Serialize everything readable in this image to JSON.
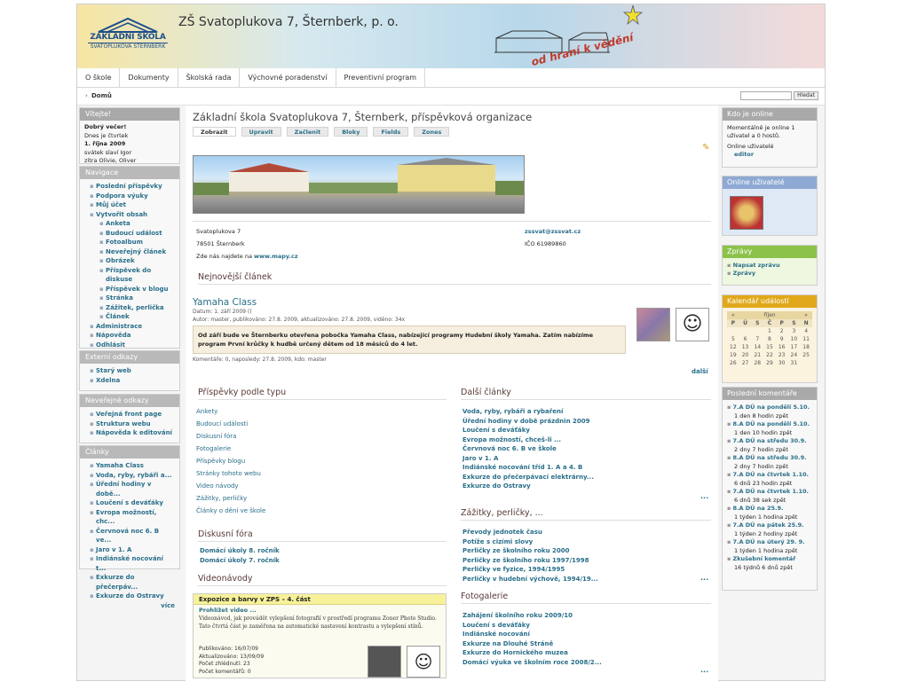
{
  "header": {
    "logo_line1": "ZÁKLADNÍ ŠKOLA",
    "logo_line2": "SVATOPLUKOVA ŠTERNBERK",
    "title": "ZŠ Svatoplukova 7, Šternberk, p. o.",
    "motto": "od hraní k vědění"
  },
  "nav": [
    "O škole",
    "Dokumenty",
    "Školská rada",
    "Výchovné poradenství",
    "Preventivní program"
  ],
  "breadcrumb": "Domů",
  "search": {
    "button": "Hledat"
  },
  "welcome": {
    "title": "Vítejte!",
    "greeting": "Dobrý večer!",
    "l2": "Dnes je čtvrtek",
    "l3": "1. října 2009",
    "l4": "svátek slaví Igor",
    "l5": "zítra Olivie, Oliver"
  },
  "navigace": {
    "title": "Navigace",
    "items": [
      "Poslední příspěvky",
      "Podpora výuky",
      "Můj účet",
      "Vytvořit obsah"
    ],
    "sub": [
      "Anketa",
      "Budoucí událost",
      "Fotoalbum",
      "Neveřejný článek",
      "Obrázek",
      "Příspěvek do diskuse",
      "Příspěvek v blogu",
      "Stránka",
      "Zážitek, perlička",
      "Článek"
    ],
    "after": [
      "Administrace",
      "Nápověda",
      "Odhlásit"
    ]
  },
  "externi": {
    "title": "Externí odkazy",
    "items": [
      "Starý web",
      "Xdelna"
    ]
  },
  "neverejne": {
    "title": "Neveřejné odkazy",
    "items": [
      "Veřejná front page",
      "Struktura webu",
      "Nápověda k editování"
    ]
  },
  "clanky": {
    "title": "Články",
    "items": [
      "Yamaha Class",
      "Voda, ryby, rybáři a...",
      "Úřední hodiny v době...",
      "Loučení s deváťáky",
      "Evropa možností, chc...",
      "Červnová noc 6. B ve...",
      "Jaro v 1. A",
      "Indiánské nocování t...",
      "Exkurze do přečerpáv...",
      "Exkurze do Ostravy"
    ],
    "more": "více"
  },
  "main": {
    "title": "Základní škola Svatoplukova 7, Šternberk, příspěvková organizace",
    "tabs": [
      "Zobrazit",
      "Upravit",
      "Začlenit",
      "Bloky",
      "Fields",
      "Zones"
    ]
  },
  "address": {
    "street": "Svatoplukova 7",
    "city": "78501 Šternberk",
    "map_text": "Zde nás najdete na",
    "map_link": "www.mapy.cz",
    "email": "zssvat@zssvat.cz",
    "ico": "IČO 61989860"
  },
  "newest": {
    "section": "Nejnovější článek",
    "title": "Yamaha Class",
    "date": "Datum: 1. září 2009 ()",
    "meta": "Autor: master, publikováno: 27.8. 2009, aktualizováno: 27.8. 2009, viděno: 34x",
    "body": "Od září bude ve Šternberku otevřena pobočka Yamaha Class, nabízející programy Hudební školy Yamaha. Zatím nabízíme program První krůčky k hudbě určený dětem od 18 měsíců do 4 let.",
    "footer": "Komentáře: 0, naposledy: 27.8. 2009, kdo: master",
    "more": "další"
  },
  "types": {
    "section": "Příspěvky podle typu",
    "items": [
      "Ankety",
      "Budoucí události",
      "Diskusní fóra",
      "Fotogalerie",
      "Příspěvky blogu",
      "Stránky tohoto webu",
      "Video návody",
      "Zážitky, perličky",
      "Články o dění ve škole"
    ]
  },
  "dalsi": {
    "section": "Další články",
    "items": [
      "Voda, ryby, rybáři a rybaření",
      "Úřední hodiny v době prázdnin 2009",
      "Loučení s deváťáky",
      "Evropa možností, chceš-li ...",
      "Červnová noc 6. B ve škole",
      "Jaro v 1. A",
      "Indiánské nocování tříd 1. A a 4. B",
      "Exkurze do přečerpávací elektrárny...",
      "Exkurze do Ostravy"
    ],
    "more": "..."
  },
  "diskuse": {
    "section": "Diskusní fóra",
    "items": [
      "Domácí úkoly 8. ročník",
      "Domácí úkoly 7. ročník"
    ]
  },
  "zazitky": {
    "section": "Zážitky, perličky, ...",
    "items": [
      "Převody jednotek času",
      "Potíže s cizími slovy",
      "Perličky ze školního roku 2000",
      "Perličky ze školního roku 1997/1998",
      "Perličky ve fyzice, 1994/1995",
      "Perličky v hudební výchově, 1994/19..."
    ],
    "more": "..."
  },
  "video": {
    "section": "Videonávody",
    "title": "Expozice a barvy v ZPS – 4. část",
    "link": "Prohlížet video ...",
    "text": "Videonávod, jak provádět vylepšení fotografií v prostředí programu Zoner Photo Studio. Tato čtvrtá část je zaměřena na automatické nastavení kontrastu a vylepšení stínů.",
    "p1": "Publikováno: 16/07/09",
    "p2": "Aktualizováno: 13/09/09",
    "p3": "Počet zhlédnutí: 23",
    "p4": "Počet komentářů: 0"
  },
  "foto": {
    "section": "Fotogalerie",
    "items": [
      "Zahájení školního roku 2009/10",
      "Loučení s deváťáky",
      "Indiánské nocování",
      "Exkurze na Dlouhé Stráně",
      "Exkurze do Hornického muzea",
      "Domácí výuka ve školním roce 2008/2..."
    ],
    "more": "..."
  },
  "online": {
    "title": "Kdo je online",
    "text": "Momentálně je online 1 uživatel a 0 hostů.",
    "sub": "Online uživatelé",
    "user": "editor"
  },
  "online2": {
    "title": "Online uživatelé"
  },
  "zpravy": {
    "title": "Zprávy",
    "items": [
      "Napsat zprávu",
      "Zprávy"
    ]
  },
  "kalendar": {
    "title": "Kalendář událostí",
    "prev": "«",
    "month": "říjen",
    "next": "»",
    "days": [
      "P",
      "Ú",
      "S",
      "Č",
      "P",
      "S",
      "N"
    ],
    "weeks": [
      [
        "",
        "",
        "",
        "1",
        "2",
        "3",
        "4"
      ],
      [
        "5",
        "6",
        "7",
        "8",
        "9",
        "10",
        "11"
      ],
      [
        "12",
        "13",
        "14",
        "15",
        "16",
        "17",
        "18"
      ],
      [
        "19",
        "20",
        "21",
        "22",
        "23",
        "24",
        "25"
      ],
      [
        "26",
        "27",
        "28",
        "29",
        "30",
        "31",
        ""
      ]
    ]
  },
  "komentare": {
    "title": "Poslední komentáře",
    "items": [
      [
        "7.A DÚ na pondělí 5.10.",
        "1 den 8 hodin zpět"
      ],
      [
        "8.A DÚ na pondělí 5.10.",
        "1 den 10 hodin zpět"
      ],
      [
        "7.A DÚ na středu 30.9.",
        "2 dny 7 hodin zpět"
      ],
      [
        "8.A DÚ na středu 30.9.",
        "2 dny 7 hodin zpět"
      ],
      [
        "7.A DÚ na čtvrtek 1.10.",
        "6 dnů 23 hodin zpět"
      ],
      [
        "7.A DÚ na čtvrtek 1.10.",
        "6 dnů 38 sek zpět"
      ],
      [
        "8.A DÚ na 25.9.",
        "1 týden 1 hodina zpět"
      ],
      [
        "7.A DÚ na pátek 25.9.",
        "1 týden 2 hodiny zpět"
      ],
      [
        "7.A DÚ na úterý 29. 9.",
        "1 týden 1 hodina zpět"
      ],
      [
        "Zkušební komentář",
        "16 týdnů 6 dnů zpět"
      ]
    ]
  }
}
